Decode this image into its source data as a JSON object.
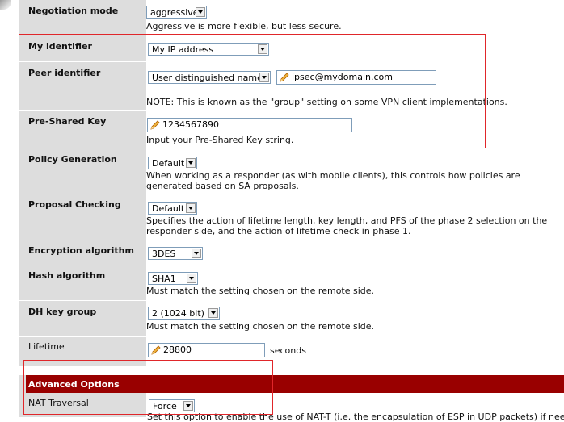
{
  "rows": {
    "negotiation_mode": {
      "label": "Negotiation mode",
      "select": "aggressive",
      "help": "Aggressive is more flexible, but less secure."
    },
    "my_identifier": {
      "label": "My identifier",
      "select": "My IP address"
    },
    "peer_identifier": {
      "label": "Peer identifier",
      "select": "User distinguished name",
      "input": "ipsec@mydomain.com",
      "note": "NOTE: This is known as the \"group\" setting on some VPN client implementations."
    },
    "pre_shared_key": {
      "label": "Pre-Shared Key",
      "input": "1234567890",
      "help": "Input your Pre-Shared Key string."
    },
    "policy_generation": {
      "label": "Policy Generation",
      "select": "Default",
      "help": "When working as a responder (as with mobile clients), this controls how policies are generated based on SA proposals."
    },
    "proposal_checking": {
      "label": "Proposal Checking",
      "select": "Default",
      "help": "Specifies the action of lifetime length, key length, and PFS of the phase 2 selection on the responder side, and the action of lifetime check in phase 1."
    },
    "encryption_algorithm": {
      "label": "Encryption algorithm",
      "select": "3DES"
    },
    "hash_algorithm": {
      "label": "Hash algorithm",
      "select": "SHA1",
      "help": "Must match the setting chosen on the remote side."
    },
    "dh_key_group": {
      "label": "DH key group",
      "select": "2 (1024 bit)",
      "help": "Must match the setting chosen on the remote side."
    },
    "lifetime": {
      "label": "Lifetime",
      "input": "28800",
      "unit": "seconds"
    },
    "nat_traversal": {
      "label": "NAT Traversal",
      "select": "Force",
      "help_clipped": "Set this option to enable the use of NAT-T (i.e. the encapsulation of ESP in UDP packets) if needed"
    }
  },
  "advanced_section": {
    "title": "Advanced Options"
  },
  "colors": {
    "section_header": "#990000",
    "highlight_box": "#e0262a",
    "label_bg": "#dddddd"
  },
  "icons": {
    "input_icon": "pencil-icon",
    "dropdown_icon": "chevron-down-icon"
  }
}
